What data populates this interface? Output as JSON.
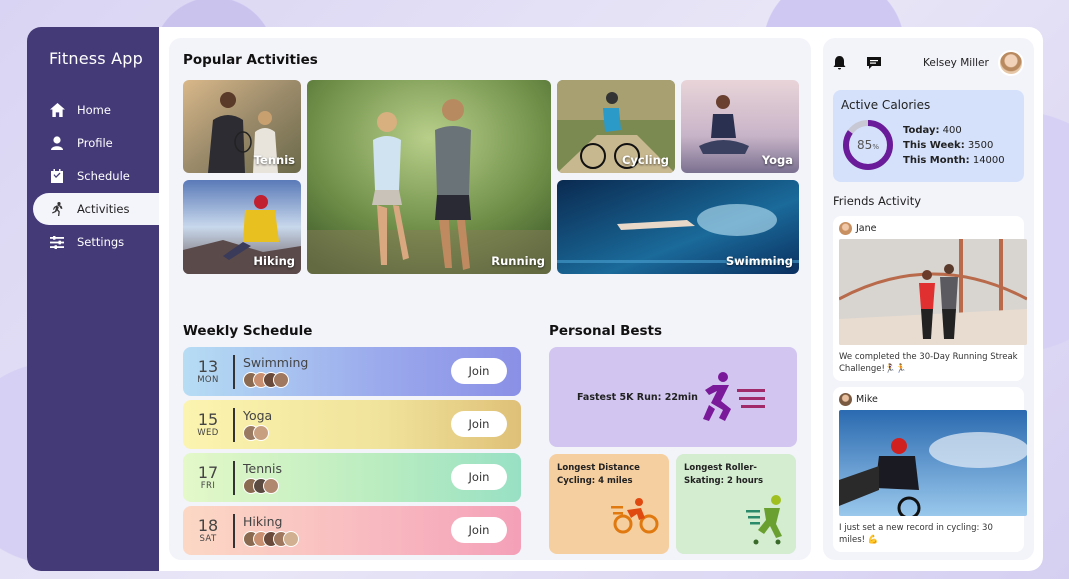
{
  "app": {
    "title": "Fitness App"
  },
  "sidebar": {
    "items": [
      {
        "label": "Home",
        "icon": "home-icon"
      },
      {
        "label": "Profile",
        "icon": "user-icon"
      },
      {
        "label": "Schedule",
        "icon": "calendar-check-icon"
      },
      {
        "label": "Activities",
        "icon": "running-icon",
        "active": true
      },
      {
        "label": "Settings",
        "icon": "sliders-icon"
      }
    ]
  },
  "popular": {
    "title": "Popular Activities",
    "tiles": [
      {
        "label": "Tennis"
      },
      {
        "label": "Running"
      },
      {
        "label": "Cycling"
      },
      {
        "label": "Yoga"
      },
      {
        "label": "Hiking"
      },
      {
        "label": "Swimming"
      }
    ]
  },
  "schedule": {
    "title": "Weekly Schedule",
    "join_label": "Join",
    "items": [
      {
        "day": "13",
        "weekday": "MON",
        "activity": "Swimming"
      },
      {
        "day": "15",
        "weekday": "WED",
        "activity": "Yoga"
      },
      {
        "day": "17",
        "weekday": "FRI",
        "activity": "Tennis"
      },
      {
        "day": "18",
        "weekday": "SAT",
        "activity": "Hiking"
      }
    ]
  },
  "bests": {
    "title": "Personal Bests",
    "main": "Fastest 5K Run: 22min",
    "cycling": "Longest Distance Cycling: 4 miles",
    "skating": "Longest Roller-Skating: 2 hours"
  },
  "user": {
    "name": "Kelsey Miller"
  },
  "calories": {
    "title": "Active Calories",
    "percent": 85,
    "percent_label": "85",
    "percent_unit": "%",
    "today_label": "Today:",
    "today": "400",
    "week_label": "This Week:",
    "week": "3500",
    "month_label": "This Month:",
    "month": "14000"
  },
  "friends": {
    "title": "Friends Activity",
    "posts": [
      {
        "name": "Jane",
        "text": "We completed the 30-Day Running Streak Challenge!🏃‍♀️🏃"
      },
      {
        "name": "Mike",
        "text": "I just set a new record in cycling: 30 miles! 💪"
      }
    ]
  },
  "colors": {
    "sidebar": "#453a78",
    "accent": "#6a1b9a"
  }
}
